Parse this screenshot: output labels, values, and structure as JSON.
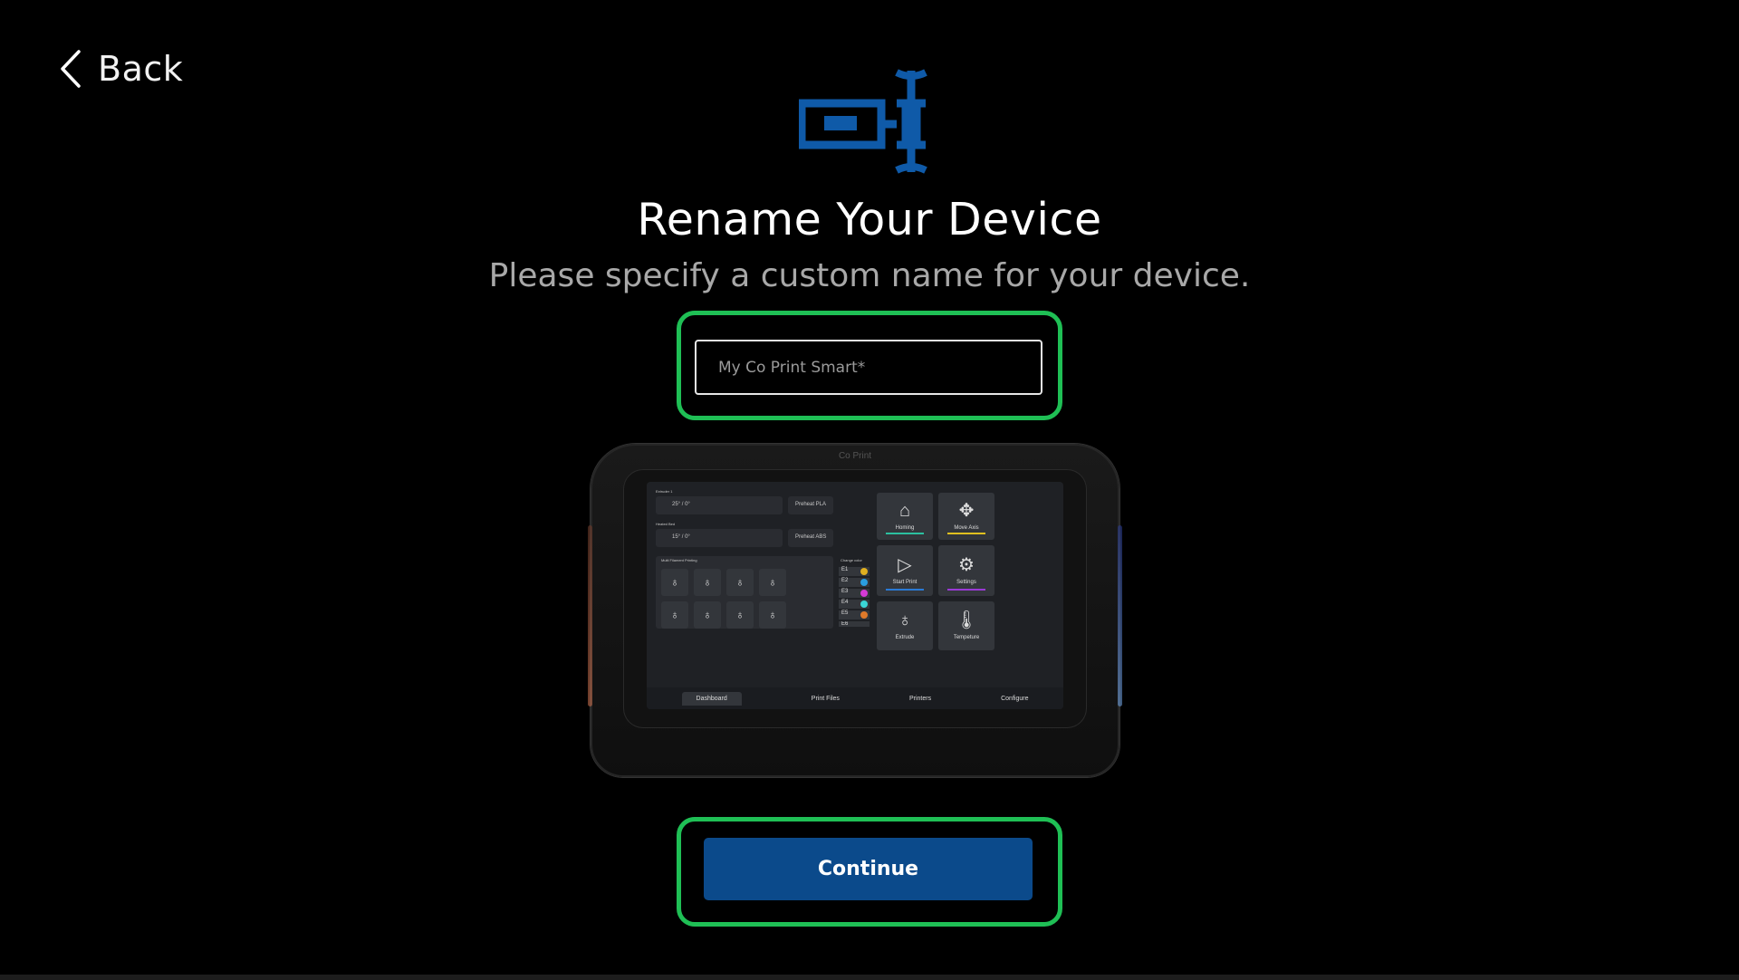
{
  "header": {
    "back_label": "Back"
  },
  "title": "Rename Your Device",
  "subtitle": "Please specify a custom name for your device.",
  "name_input": {
    "value": "",
    "placeholder": "My Co Print Smart*"
  },
  "continue_label": "Continue",
  "colors": {
    "accent": "#0b4a8b",
    "logo": "#0f5aa8",
    "highlight": "#1fbf55",
    "background": "#000000"
  },
  "device_screen": {
    "brand": "Co Print",
    "extruder_label": "Extruder 1",
    "extruder_temp": "25° / 0°",
    "bed_label": "Heated Bed",
    "bed_temp": "15° / 0°",
    "preheat_pla": "Preheat PLA",
    "preheat_abs": "Preheat ABS",
    "filament_section": "Multi Filament Printing",
    "change_color": "Change color",
    "extruders": [
      "E1",
      "E2",
      "E3",
      "E4",
      "E5",
      "E6"
    ],
    "tiles": [
      "Homing",
      "Move Axis",
      "Start Print",
      "Settings",
      "Extrude",
      "Tempeture"
    ],
    "nav": [
      "Dashboard",
      "Print Files",
      "Printers",
      "Configure"
    ]
  }
}
